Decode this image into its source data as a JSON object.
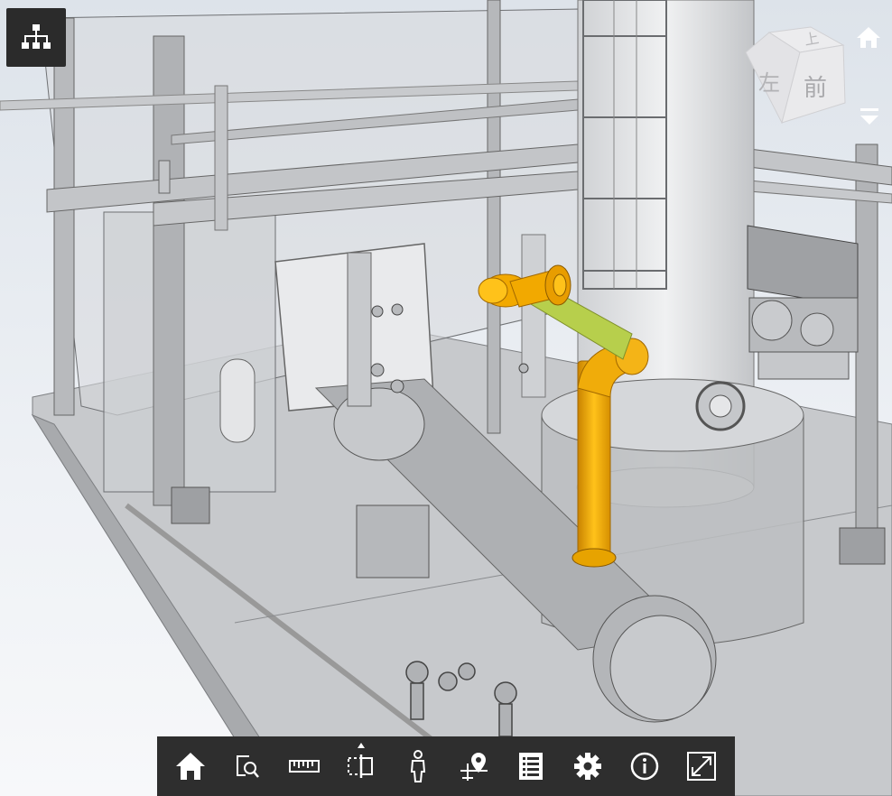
{
  "viewer": {
    "viewcube": {
      "top_label": "上",
      "left_label": "左",
      "front_label": "前"
    },
    "colors": {
      "selection_orange": "#f2a900",
      "selection_green": "#b7cf4c",
      "toolbar_bg": "#2e2e2e",
      "icon": "#ffffff"
    }
  },
  "toolbar": {
    "items": [
      {
        "name": "home",
        "icon": "home-icon"
      },
      {
        "name": "zoom-window",
        "icon": "zoom-box-icon"
      },
      {
        "name": "measure",
        "icon": "ruler-icon"
      },
      {
        "name": "section",
        "icon": "section-box-icon"
      },
      {
        "name": "walk",
        "icon": "person-icon"
      },
      {
        "name": "location",
        "icon": "map-pin-icon"
      },
      {
        "name": "properties",
        "icon": "document-list-icon"
      },
      {
        "name": "settings",
        "icon": "gear-icon"
      },
      {
        "name": "info",
        "icon": "info-icon"
      },
      {
        "name": "fullscreen",
        "icon": "expand-icon"
      }
    ]
  }
}
